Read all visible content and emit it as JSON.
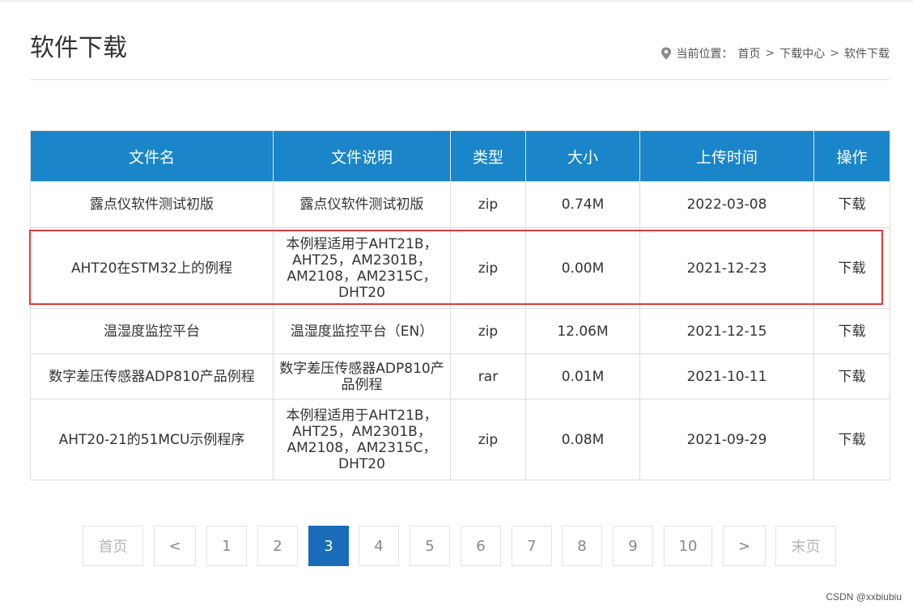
{
  "header": {
    "title": "软件下载",
    "location_label": "当前位置：",
    "crumbs": [
      "首页",
      "下载中心",
      "软件下载"
    ],
    "separator": ">"
  },
  "table": {
    "columns": [
      "文件名",
      "文件说明",
      "类型",
      "大小",
      "上传时间",
      "操作"
    ],
    "rows": [
      {
        "name": "露点仪软件测试初版",
        "desc": "露点仪软件测试初版",
        "type": "zip",
        "size": "0.74M",
        "date": "2022-03-08",
        "action": "下载"
      },
      {
        "name": "AHT20在STM32上的例程",
        "desc": "本例程适用于AHT21B，AHT25，AM2301B，AM2108，AM2315C，DHT20",
        "type": "zip",
        "size": "0.00M",
        "date": "2021-12-23",
        "action": "下载"
      },
      {
        "name": "温湿度监控平台",
        "desc": "温湿度监控平台（EN）",
        "type": "zip",
        "size": "12.06M",
        "date": "2021-12-15",
        "action": "下载"
      },
      {
        "name": "数字差压传感器ADP810产品例程",
        "desc": "数字差压传感器ADP810产品例程",
        "type": "rar",
        "size": "0.01M",
        "date": "2021-10-11",
        "action": "下载"
      },
      {
        "name": "AHT20-21的51MCU示例程序",
        "desc": "本例程适用于AHT21B，AHT25，AM2301B，AM2108，AM2315C，DHT20",
        "type": "zip",
        "size": "0.08M",
        "date": "2021-09-29",
        "action": "下载"
      }
    ]
  },
  "pagination": {
    "first": "首页",
    "prev": "<",
    "pages": [
      "1",
      "2",
      "3",
      "4",
      "5",
      "6",
      "7",
      "8",
      "9",
      "10"
    ],
    "current": "3",
    "next": ">",
    "last": "末页"
  },
  "colors": {
    "header_bg": "#1a85c9",
    "active_page": "#1a6cb8",
    "highlight": "#e23b3b"
  },
  "icons": {
    "location": "map-pin-icon"
  },
  "watermark": "CSDN @xxbiubiu"
}
